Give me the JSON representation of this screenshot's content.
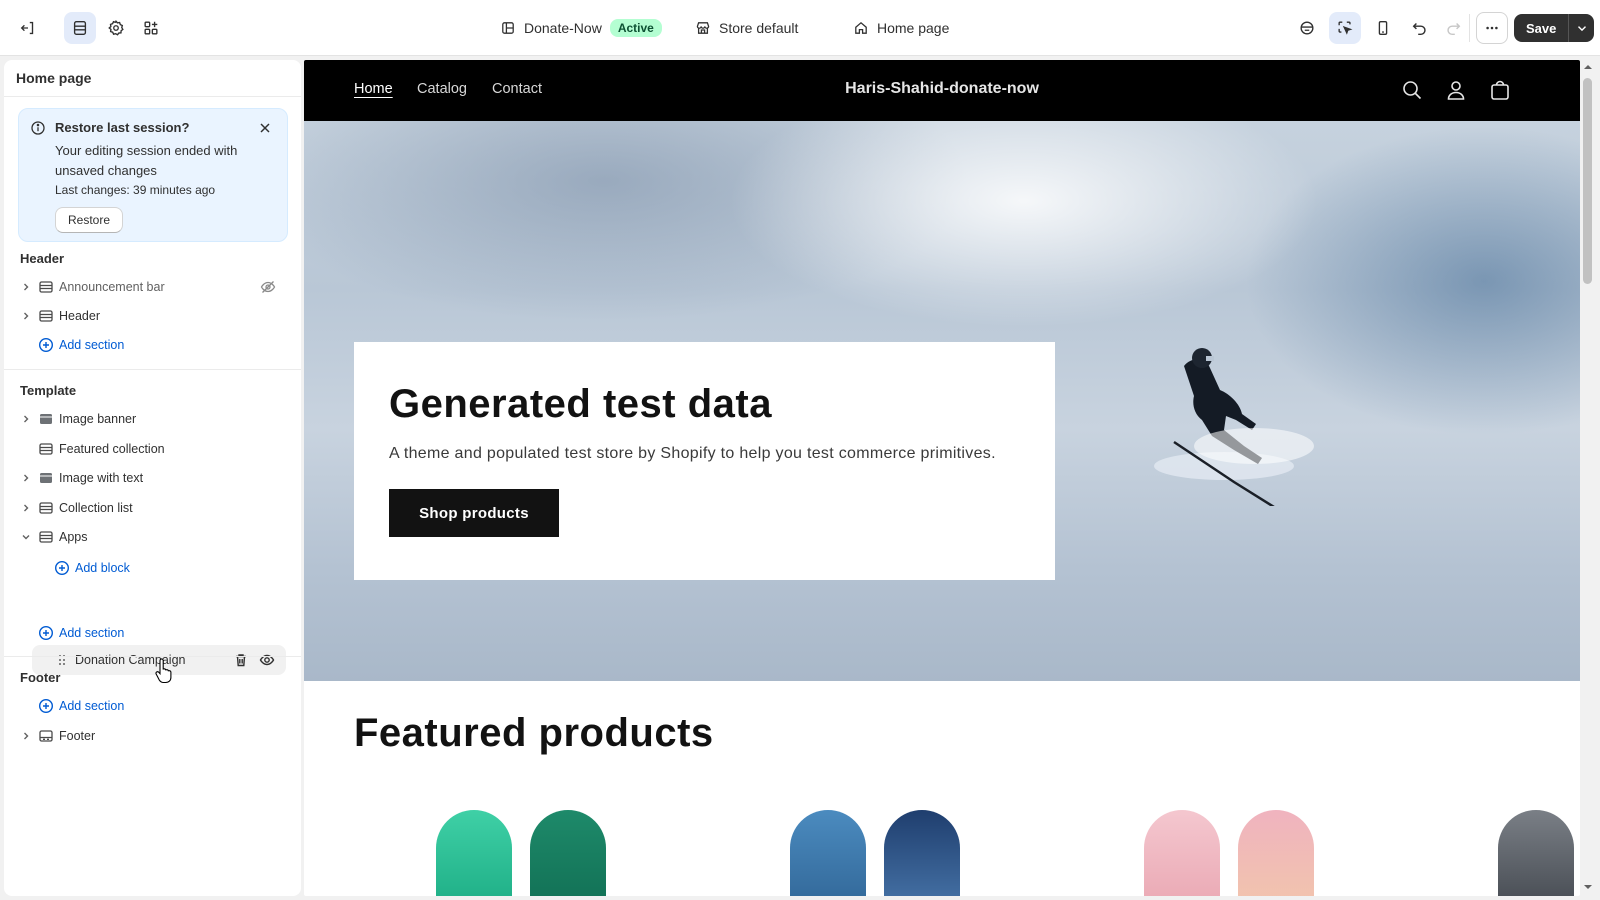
{
  "topbar": {
    "theme_name": "Donate-Now",
    "theme_status": "Active",
    "store_context": "Store default",
    "page_context": "Home page",
    "save_label": "Save"
  },
  "sidebar": {
    "title": "Home page",
    "restore": {
      "title": "Restore last session?",
      "body": "Your editing session ended with unsaved changes",
      "last_changes": "Last changes: 39 minutes ago",
      "button": "Restore"
    },
    "header_group": {
      "title": "Header",
      "items": [
        {
          "label": "Announcement bar",
          "icon": "section-icon",
          "hidden": true
        },
        {
          "label": "Header",
          "icon": "section-icon"
        }
      ],
      "add_section": "Add section"
    },
    "template_group": {
      "title": "Template",
      "items": [
        {
          "label": "Image banner",
          "icon": "image-icon"
        },
        {
          "label": "Featured collection",
          "icon": "section-icon"
        },
        {
          "label": "Image with text",
          "icon": "image-icon"
        },
        {
          "label": "Collection list",
          "icon": "section-icon"
        },
        {
          "label": "Apps",
          "icon": "section-icon",
          "expanded": true
        }
      ],
      "add_block": "Add block",
      "app_block": "Donation Campaign",
      "add_section": "Add section"
    },
    "footer_group": {
      "title": "Footer",
      "add_section": "Add section",
      "items": [
        {
          "label": "Footer",
          "icon": "footer-icon"
        }
      ]
    }
  },
  "preview": {
    "nav": [
      "Home",
      "Catalog",
      "Contact"
    ],
    "store_name": "Haris-Shahid-donate-now",
    "hero": {
      "heading": "Generated test data",
      "subheading": "A theme and populated test store by Shopify to help you test commerce primitives.",
      "button": "Shop products"
    },
    "featured_title": "Featured products"
  },
  "colors": {
    "accent": "#005bd3",
    "active_badge_bg": "#b4fed2",
    "active_badge_text": "#0c5132",
    "restore_bg": "#eaf4ff",
    "store_header_bg": "#000000"
  }
}
